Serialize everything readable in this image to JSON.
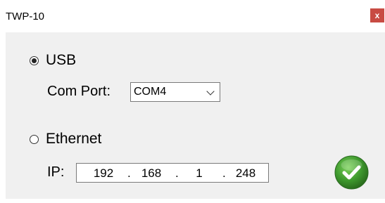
{
  "window": {
    "title": "TWP-10",
    "close_glyph": "x"
  },
  "connection": {
    "usb": {
      "label": "USB",
      "checked": true
    },
    "com_port": {
      "label": "Com Port:",
      "value": "COM4"
    },
    "ethernet": {
      "label": "Ethernet",
      "checked": false
    },
    "ip": {
      "label": "IP:",
      "octets": [
        "192",
        "168",
        "1",
        "248"
      ],
      "separator": "."
    }
  },
  "icons": {
    "ok": "checkmark-circle-icon",
    "dropdown": "chevron-down-icon"
  },
  "colors": {
    "close_button": "#c84b43",
    "ok_button": "#3f9a2e",
    "client_bg": "#f0f0f0"
  }
}
